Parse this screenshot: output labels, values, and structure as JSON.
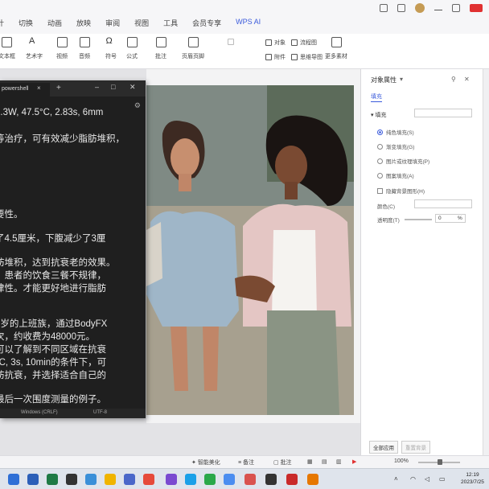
{
  "menubar": {
    "tabs": [
      "计",
      "切换",
      "动画",
      "放映",
      "审阅",
      "视图",
      "工具",
      "会员专享",
      "WPS AI"
    ]
  },
  "ribbon": {
    "buttons": [
      "文本框",
      "艺术字",
      "视频",
      "音频",
      "符号",
      "公式",
      "批注",
      "页眉页脚"
    ],
    "small": [
      "对象",
      "流程图",
      "附件",
      "思维导图",
      "更多素材"
    ]
  },
  "terminal": {
    "tab_title": "powershell",
    "lines": [
      "2.3W, 47.5°C, 2.83s, 6mm",
      "等治疗，可有效减少脂肪堆积，",
      "",
      "",
      "要性。",
      "了4.5厘米，下腹减少了3厘",
      "",
      "肪堆积，达到抗衰老的效果。",
      "。患者的饮食三餐不规律，",
      "律性。才能更好地进行脂肪",
      "",
      "7岁的上班族，通过BodyFX",
      "次，约收费为48000元。",
      "可以了解到不同区域在抗衰",
      "°C, 3s, 10min的条件下，可",
      "肪抗衰，并选择适合自己的",
      "",
      "最后一次围度测量的例子。"
    ],
    "status_encoding": "UTF-8",
    "status_lineend": "Windows (CRLF)"
  },
  "props": {
    "title": "对象属性",
    "subtab": "填充",
    "section": "填充",
    "options": [
      "纯色填充(S)",
      "渐变填充(G)",
      "图片或纹理填充(P)",
      "图案填充(A)"
    ],
    "checkbox": "隐藏背景图形(H)",
    "color_label": "颜色(C)",
    "transparency_label": "透明度(T)",
    "transparency_value": "0",
    "transparency_unit": "%",
    "apply_all": "全部应用",
    "reset": "重置背景"
  },
  "statusbar": {
    "smart": "智能美化",
    "notes": "备注",
    "comments": "批注",
    "zoom": "100%"
  },
  "taskbar": {
    "time": "12:19",
    "date": "2023/7/25"
  },
  "colors": {
    "accent": "#3b5bdb",
    "terminal_bg": "#1f1f1f"
  }
}
